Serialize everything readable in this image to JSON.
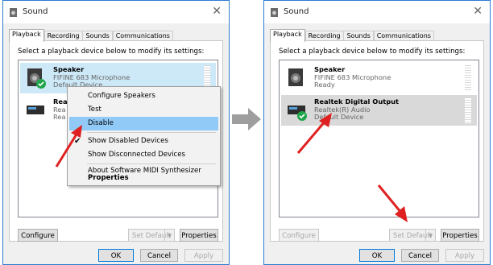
{
  "left": {
    "title": "Sound",
    "tabs": [
      "Playback",
      "Recording",
      "Sounds",
      "Communications"
    ],
    "instruction": "Select a playback device below to modify its settings:",
    "devices": [
      {
        "name": "Speaker",
        "sub": "FIFINE 683 Microphone",
        "status": "Default Device"
      },
      {
        "name": "Rea",
        "sub": "Rea",
        "status": "Rea"
      }
    ],
    "context_menu": [
      "Configure Speakers",
      "Test",
      "Disable",
      "Show Disabled Devices",
      "Show Disconnected Devices",
      "About Software MIDI Synthesizer",
      "Properties"
    ],
    "buttons": {
      "configure": "Configure",
      "set_default": "Set Default",
      "properties": "Properties",
      "ok": "OK",
      "cancel": "Cancel",
      "apply": "Apply"
    }
  },
  "right": {
    "title": "Sound",
    "tabs": [
      "Playback",
      "Recording",
      "Sounds",
      "Communications"
    ],
    "instruction": "Select a playback device below to modify its settings:",
    "devices": [
      {
        "name": "Speaker",
        "sub": "FIFINE 683 Microphone",
        "status": "Ready"
      },
      {
        "name": "Realtek Digital Output",
        "sub": "Realtek(R) Audio",
        "status": "Default Device"
      }
    ],
    "buttons": {
      "configure": "Configure",
      "set_default": "Set Default",
      "properties": "Properties",
      "ok": "OK",
      "cancel": "Cancel",
      "apply": "Apply"
    }
  },
  "colors": {
    "accent": "#0078d7",
    "selection": "#cde8f7",
    "highlight": "#91c9f7",
    "check_green": "#1fa64a",
    "red_arrow": "#e02020"
  }
}
